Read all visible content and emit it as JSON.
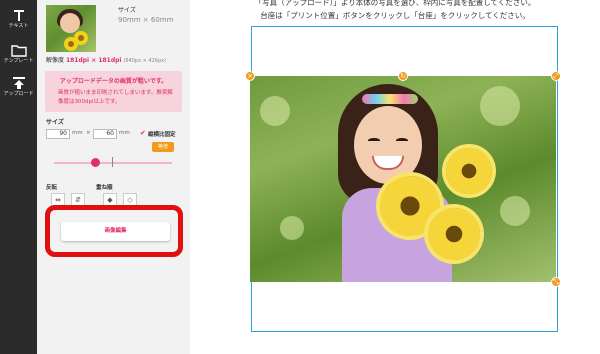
{
  "toolbar": {
    "items": [
      {
        "label": "テキスト",
        "icon": "text-icon"
      },
      {
        "label": "テンプレート",
        "icon": "folder-icon"
      },
      {
        "label": "アップロード",
        "icon": "upload-icon"
      }
    ]
  },
  "panel": {
    "size_label": "サイズ",
    "size_value": "90mm × 60mm",
    "resolution_label": "解像度",
    "resolution_value": "181dpi × 181dpi",
    "resolution_pixels": "(640px × 426px)",
    "warning_title": "アップロードデータの画質が粗いです。",
    "warning_body": "画質が粗いまま印刷されてしまいます。推奨解像度は300dpi以上です。",
    "size_section_title": "サイズ",
    "width_value": "90",
    "height_value": "60",
    "unit_mm": "mm",
    "times": "×",
    "lock_ratio_label": "縦横比固定",
    "same_size_button": "等倍",
    "zoom_level": 0.35,
    "flip_title": "反転",
    "layer_title": "重ね順",
    "edit_button": "画像編集"
  },
  "canvas": {
    "instruction_line1": "「写真（アップロード）」より本体の写真を選び、枠内に写真を配置してください。",
    "instruction_line2": "台座は「プリント位置」ボタンをクリックし「台座」をクリックしてください。"
  },
  "colors": {
    "accent_pink": "#e0306a",
    "orange": "#f39a1c",
    "frame_blue": "#2aa6d6",
    "highlight_red": "#e01010"
  }
}
